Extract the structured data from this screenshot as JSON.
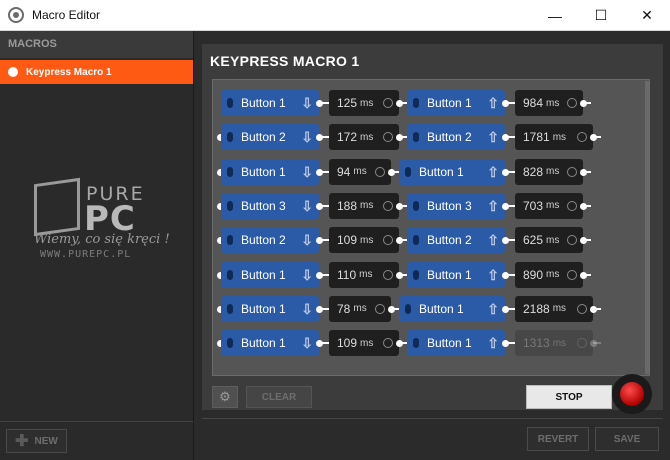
{
  "window": {
    "title": "Macro Editor",
    "minimize": "—",
    "maximize": "☐",
    "close": "✕"
  },
  "sidebar": {
    "header": "MACROS",
    "items": [
      {
        "label": "Keypress Macro 1",
        "selected": true
      }
    ],
    "new_label": "NEW"
  },
  "logo": {
    "pure": "PURE",
    "pc": "PC",
    "slogan": "Wiemy, co się kręci !",
    "url": "WWW.PUREPC.PL"
  },
  "editor": {
    "title": "KEYPRESS MACRO 1",
    "rows": [
      {
        "b1": "Button 1",
        "d1": "125",
        "b2": "Button 1",
        "d2": "984"
      },
      {
        "b1": "Button 2",
        "d1": "172",
        "b2": "Button 2",
        "d2": "1781"
      },
      {
        "b1": "Button 1",
        "d1": "94",
        "b2": "Button 1",
        "d2": "828"
      },
      {
        "b1": "Button 3",
        "d1": "188",
        "b2": "Button 3",
        "d2": "703"
      },
      {
        "b1": "Button 2",
        "d1": "109",
        "b2": "Button 2",
        "d2": "625"
      },
      {
        "b1": "Button 1",
        "d1": "110",
        "b2": "Button 1",
        "d2": "890"
      },
      {
        "b1": "Button 1",
        "d1": "78",
        "b2": "Button 1",
        "d2": "2188"
      },
      {
        "b1": "Button 1",
        "d1": "109",
        "b2": "Button 1",
        "d2": "1313"
      }
    ],
    "unit": "ms",
    "down_arrow": "⇩",
    "up_arrow": "⇧",
    "clear_label": "CLEAR",
    "stop_label": "STOP",
    "gear_icon": "⚙"
  },
  "footer": {
    "revert_label": "REVERT",
    "save_label": "SAVE"
  },
  "colors": {
    "accent": "#ff5a14",
    "button_chip": "#2b5aa6",
    "delay_chip": "#1f1f1f",
    "record": "#d00000"
  }
}
